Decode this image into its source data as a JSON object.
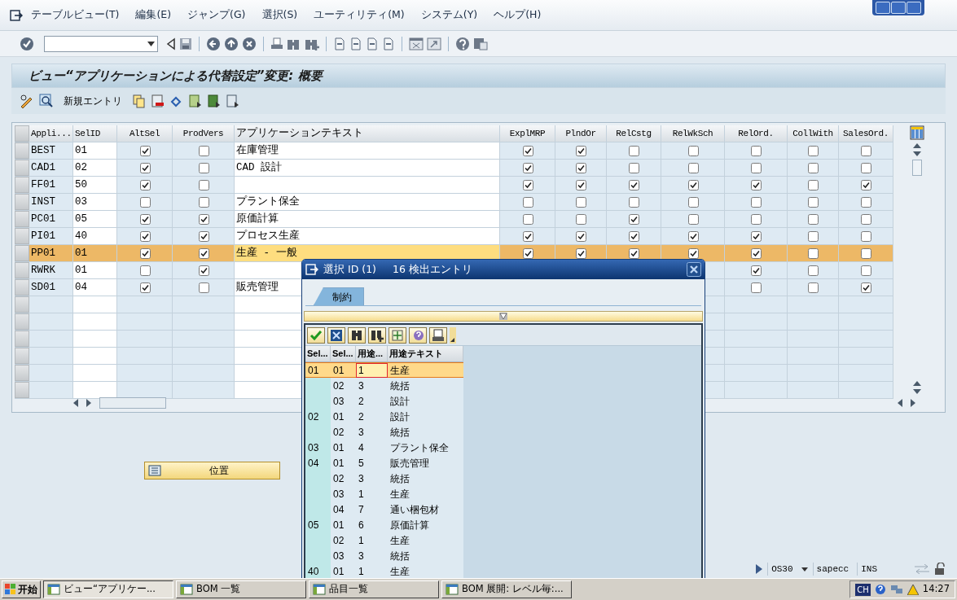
{
  "menu": [
    "テーブルビュー(T)",
    "編集(E)",
    "ジャンプ(G)",
    "選択(S)",
    "ユーティリティ(M)",
    "システム(Y)",
    "ヘルプ(H)"
  ],
  "title": "ビュー“アプリケーションによる代替設定”変更: 概要",
  "app_toolbar": {
    "new_entry": "新規エントリ"
  },
  "table": {
    "columns": [
      "Appli...",
      "SelID",
      "AltSel",
      "ProdVers",
      "アプリケーションテキスト",
      "ExplMRP",
      "PlndOr",
      "RelCstg",
      "RelWkSch",
      "RelOrd.",
      "CollWith",
      "SalesOrd."
    ],
    "rows": [
      {
        "appli": "BEST",
        "selid": "01",
        "text": "在庫管理",
        "checks": {
          "alt_sel": true,
          "prod_vers": false,
          "expl_mrp": true,
          "plnd_or": true,
          "rel_cstg": false,
          "rel_wk_sch": false,
          "rel_ord": false,
          "coll_with": false,
          "sales_ord": false
        },
        "selected": false
      },
      {
        "appli": "CAD1",
        "selid": "02",
        "text": "CAD 設計",
        "checks": {
          "alt_sel": true,
          "prod_vers": false,
          "expl_mrp": true,
          "plnd_or": true,
          "rel_cstg": false,
          "rel_wk_sch": false,
          "rel_ord": false,
          "coll_with": false,
          "sales_ord": false
        },
        "selected": false
      },
      {
        "appli": "FF01",
        "selid": "50",
        "checks": {
          "alt_sel": true,
          "prod_vers": false,
          "expl_mrp": true,
          "plnd_or": true,
          "rel_cstg": true,
          "rel_wk_sch": true,
          "rel_ord": true,
          "coll_with": false,
          "sales_ord": true
        },
        "selected": false
      },
      {
        "appli": "INST",
        "selid": "03",
        "text": "プラント保全",
        "checks": {
          "alt_sel": false,
          "prod_vers": false,
          "expl_mrp": false,
          "plnd_or": false,
          "rel_cstg": false,
          "rel_wk_sch": false,
          "rel_ord": false,
          "coll_with": false,
          "sales_ord": false
        },
        "selected": false
      },
      {
        "appli": "PC01",
        "selid": "05",
        "text": "原価計算",
        "checks": {
          "alt_sel": true,
          "prod_vers": true,
          "expl_mrp": false,
          "plnd_or": false,
          "rel_cstg": true,
          "rel_wk_sch": false,
          "rel_ord": false,
          "coll_with": false,
          "sales_ord": false
        },
        "selected": false
      },
      {
        "appli": "PI01",
        "selid": "40",
        "text": "プロセス生産",
        "checks": {
          "alt_sel": true,
          "prod_vers": true,
          "expl_mrp": true,
          "plnd_or": true,
          "rel_cstg": true,
          "rel_wk_sch": true,
          "rel_ord": true,
          "coll_with": false,
          "sales_ord": false
        },
        "selected": false
      },
      {
        "appli": "PP01",
        "selid": "01",
        "text": "生産 - 一般",
        "checks": {
          "alt_sel": true,
          "prod_vers": true,
          "expl_mrp": true,
          "plnd_or": true,
          "rel_cstg": true,
          "rel_wk_sch": true,
          "rel_ord": true,
          "coll_with": false,
          "sales_ord": false
        },
        "selected": true
      },
      {
        "appli": "RWRK",
        "selid": "01",
        "checks": {
          "alt_sel": false,
          "prod_vers": true,
          "rel_ord": true,
          "coll_with": false,
          "sales_ord": false
        },
        "selected": false
      },
      {
        "appli": "SD01",
        "selid": "04",
        "text": "販売管理",
        "checks": {
          "alt_sel": true,
          "prod_vers": false,
          "rel_ord": false,
          "coll_with": false,
          "sales_ord": true
        },
        "selected": false
      }
    ]
  },
  "position_button": "位置",
  "popup": {
    "title": "選択 ID (1)",
    "count": "16 検出エントリ",
    "tabs": [
      {
        "label": "制約",
        "selected": true
      }
    ],
    "columns": [
      "Sel...",
      "Sel...",
      "用途...",
      "用途テキスト"
    ],
    "rows": [
      {
        "cells": [
          "01",
          "01",
          "1",
          "生産"
        ],
        "selected": true
      },
      {
        "cells": [
          "",
          "02",
          "3",
          "統括"
        ],
        "selected": false
      },
      {
        "cells": [
          "",
          "03",
          "2",
          "設計"
        ],
        "selected": false
      },
      {
        "cells": [
          "02",
          "01",
          "2",
          "設計"
        ],
        "selected": false
      },
      {
        "cells": [
          "",
          "02",
          "3",
          "統括"
        ],
        "selected": false
      },
      {
        "cells": [
          "03",
          "01",
          "4",
          "プラント保全"
        ],
        "selected": false
      },
      {
        "cells": [
          "04",
          "01",
          "5",
          "販売管理"
        ],
        "selected": false
      },
      {
        "cells": [
          "",
          "02",
          "3",
          "統括"
        ],
        "selected": false
      },
      {
        "cells": [
          "",
          "03",
          "1",
          "生産"
        ],
        "selected": false
      },
      {
        "cells": [
          "",
          "04",
          "7",
          "通い梱包材"
        ],
        "selected": false
      },
      {
        "cells": [
          "05",
          "01",
          "6",
          "原価計算"
        ],
        "selected": false
      },
      {
        "cells": [
          "",
          "02",
          "1",
          "生産"
        ],
        "selected": false
      },
      {
        "cells": [
          "",
          "03",
          "3",
          "統括"
        ],
        "selected": false
      },
      {
        "cells": [
          "40",
          "01",
          "1",
          "生産"
        ],
        "selected": false
      }
    ]
  },
  "status_bar": {
    "system": "OS30",
    "server": "sapecc",
    "mode": "INS"
  },
  "taskbar": {
    "start": "开始",
    "tasks": [
      {
        "label": "ビュー“アプリケー...",
        "selected": true
      },
      {
        "label": "BOM 一覧",
        "selected": false
      },
      {
        "label": "品目一覧",
        "selected": false
      },
      {
        "label": "BOM 展開: レベル毎:...",
        "selected": false
      }
    ],
    "language": "CH",
    "clock": "14:27"
  }
}
